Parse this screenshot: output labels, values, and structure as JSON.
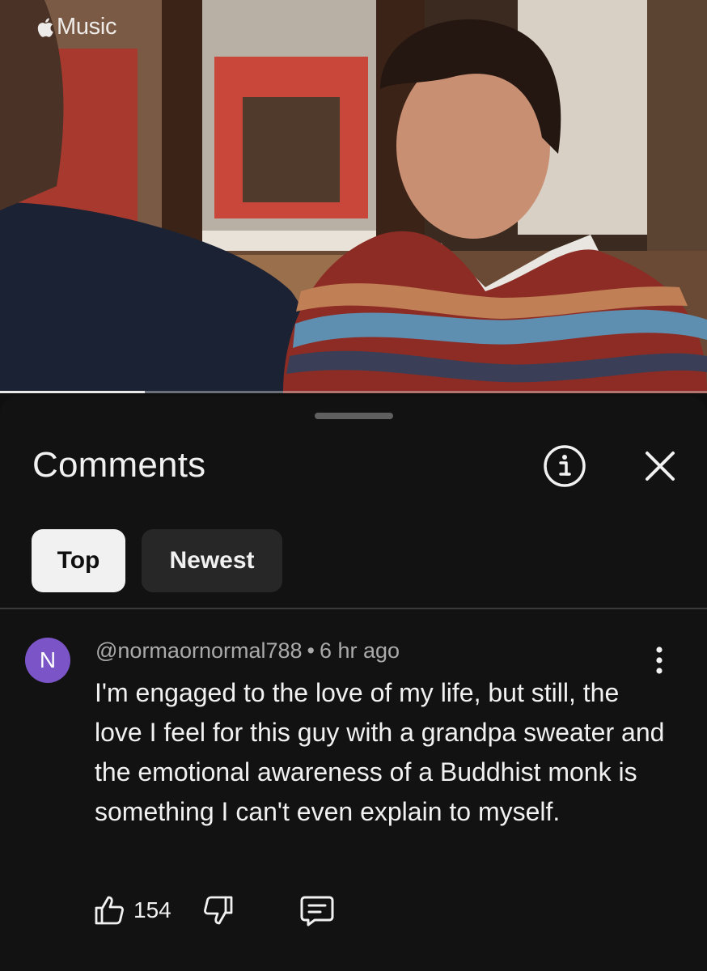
{
  "video": {
    "watermark": "Music",
    "progress_fraction": 0.205
  },
  "comments_panel": {
    "title": "Comments",
    "info_icon": "info-circle-icon",
    "close_icon": "close-icon",
    "filters": [
      {
        "label": "Top",
        "selected": true
      },
      {
        "label": "Newest",
        "selected": false
      }
    ]
  },
  "comment": {
    "avatar_letter": "N",
    "avatar_color": "#7b55c7",
    "author": "@normaornormal788",
    "separator": "•",
    "time": "6 hr ago",
    "text": "I'm engaged to the love of my life, but still, the love I feel for this guy with a grandpa sweater and the emotional awareness of a Buddhist monk is something I can't even explain to myself.",
    "like_count": "154"
  }
}
